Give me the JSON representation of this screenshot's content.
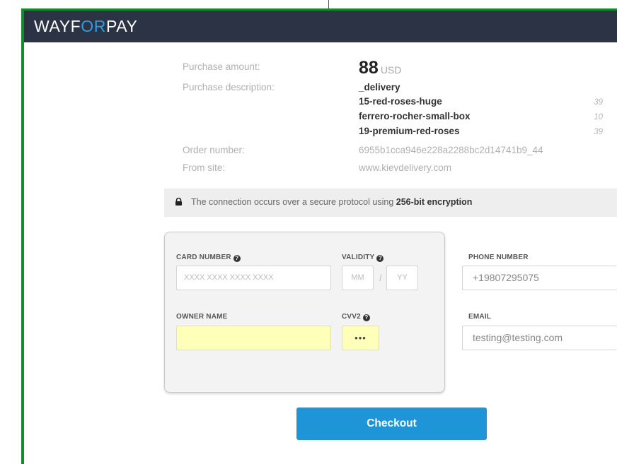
{
  "brand": {
    "logo_prefix": "WAYF",
    "logo_accent": "OR",
    "logo_suffix": "PAY",
    "header_color": "#2c3344",
    "accent_color": "#2b9fdd"
  },
  "purchase": {
    "amount_label": "Purchase amount:",
    "amount": "88",
    "currency": "USD",
    "description_label": "Purchase description:",
    "items": [
      {
        "name": "_delivery",
        "qty": ""
      },
      {
        "name": "15-red-roses-huge",
        "qty": "39"
      },
      {
        "name": "ferrero-rocher-small-box",
        "qty": "10"
      },
      {
        "name": "19-premium-red-roses",
        "qty": "39"
      }
    ],
    "order_label": "Order number:",
    "order_number": "6955b1cca946e228a2288bc2d14741b9_44",
    "site_label": "From site:",
    "site": "www.kievdelivery.com"
  },
  "security": {
    "icon": "lock-icon",
    "text": "The connection occurs over a secure protocol using",
    "highlight": "256-bit encryption"
  },
  "card_form": {
    "card_number_label": "CARD NUMBER",
    "card_number_placeholder": "XXXX XXXX XXXX XXXX",
    "validity_label": "VALIDITY",
    "month_placeholder": "MM",
    "year_placeholder": "YY",
    "separator": "/",
    "owner_label": "OWNER NAME",
    "owner_value": "",
    "cvv_label": "CVV2",
    "cvv_value": "•••",
    "help_icon": "?"
  },
  "contact_form": {
    "phone_label": "PHONE NUMBER",
    "phone_value": "+19807295075",
    "email_label": "EMAIL",
    "email_value": "testing@testing.com"
  },
  "checkout_label": "Checkout",
  "checkout_color": "#1e95d6"
}
